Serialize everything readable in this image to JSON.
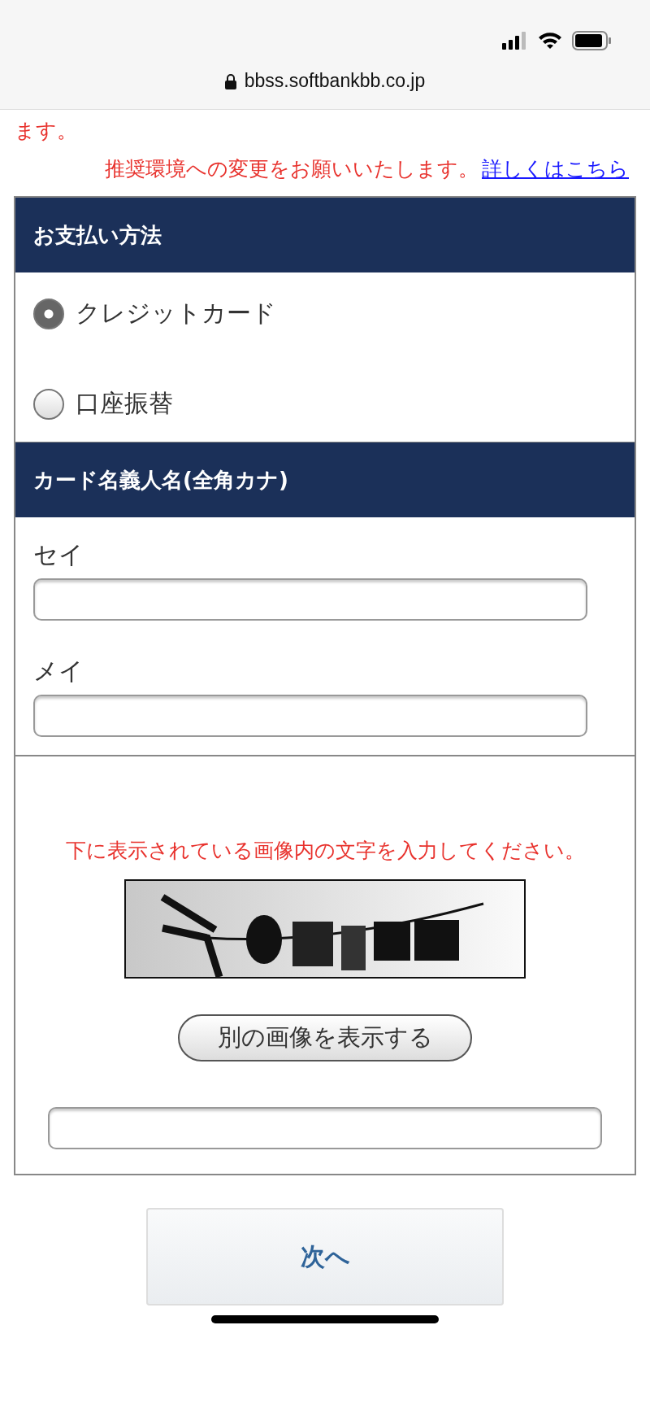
{
  "browser": {
    "url": "bbss.softbankbb.co.jp"
  },
  "notice": {
    "lines": [
      "ます。"
    ],
    "request": "推奨環境への変更をお願いいたします。",
    "link": "詳しくはこちら"
  },
  "payment": {
    "title": "お支払い方法",
    "options": [
      {
        "label": "クレジットカード",
        "selected": true
      },
      {
        "label": "口座振替",
        "selected": false
      }
    ]
  },
  "holder": {
    "title": "カード名義人名(全角カナ)",
    "fields": [
      {
        "label": "セイ"
      },
      {
        "label": "メイ"
      }
    ]
  },
  "captcha": {
    "instruction": "下に表示されている画像内の文字を入力してください。",
    "refresh_button": "別の画像を表示する"
  },
  "next_button": "次へ"
}
